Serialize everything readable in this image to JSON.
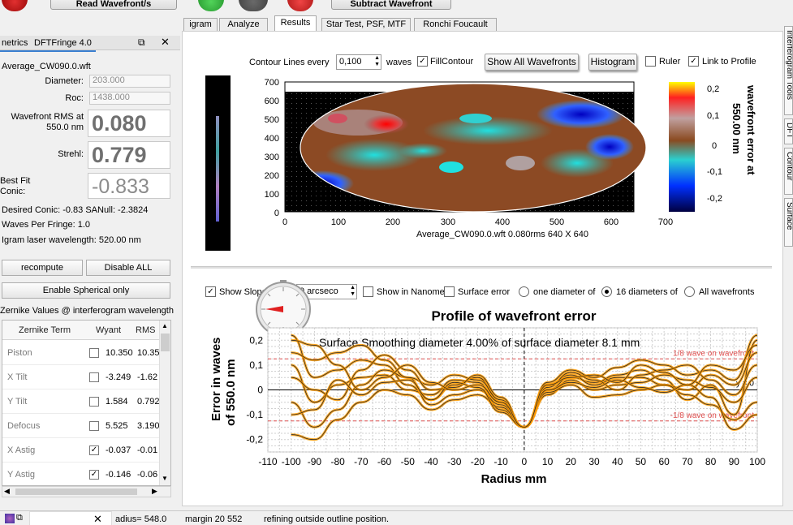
{
  "toolbar": {
    "read_wavefronts_label": "Read Wavefront/s",
    "subtract_wavefront_label": "Subtract Wavefront"
  },
  "tabs": [
    "igram",
    "Analyze",
    "Results",
    "Star Test, PSF, MTF",
    "Ronchi Foucault"
  ],
  "right_tabs": [
    "Interferogram Tools",
    "DFT",
    "Contour",
    "Surface"
  ],
  "dock": {
    "title_left": "netrics",
    "title_right": "DFTFringe 4.0",
    "file_name": "Average_CW090.0.wft",
    "diameter_label": "Diameter:",
    "diameter_value": "203.000",
    "roc_label": "Roc:",
    "roc_value": "1438.000",
    "rms_label_1": "Wavefront RMS at",
    "rms_label_2": "550.0 nm",
    "rms_value": "0.080",
    "strehl_label": "Strehl:",
    "strehl_value": "0.779",
    "bestfit_label_1": "Best Fit",
    "bestfit_label_2": "Conic:",
    "bestfit_value": "-0.833",
    "desired_conic": "Desired Conic:  -0.83 SANull:  -2.3824",
    "waves_per_fringe": "Waves Per Fringe: 1.0",
    "laser_wavelength": "Igram laser wavelength: 520.00 nm",
    "recompute_label": "recompute",
    "disable_all_label": "Disable ALL",
    "enable_spherical_label": "Enable Spherical only",
    "zernike_caption": "Zernike Values @ interferogram wavelength",
    "zernike_headers": [
      "Zernike Term",
      "Wyant",
      "RMS"
    ],
    "zernike_rows": [
      {
        "term": "Piston",
        "checked": "",
        "wyant": "10.350",
        "rms": "10.35"
      },
      {
        "term": "X Tilt",
        "checked": "",
        "wyant": "-3.249",
        "rms": "-1.62"
      },
      {
        "term": "Y Tilt",
        "checked": "",
        "wyant": "1.584",
        "rms": "0.792"
      },
      {
        "term": "Defocus",
        "checked": "",
        "wyant": "5.525",
        "rms": "3.190"
      },
      {
        "term": "X Astig",
        "checked": "✓",
        "wyant": "-0.037",
        "rms": "-0.01"
      },
      {
        "term": "Y Astig",
        "checked": "✓",
        "wyant": "-0.146",
        "rms": "-0.06"
      }
    ]
  },
  "controls": {
    "contour_lines_label": "Contour Lines every",
    "contour_value": "0,100",
    "waves_label": "waves",
    "fill_contour_label": "FillContour",
    "show_all_label": "Show All Wavefronts",
    "histogram_label": "Histogram",
    "ruler_label": "Ruler",
    "link_profile_label": "Link to Profile",
    "show_slope_label": "Show Slope",
    "arcsec_value": "0 arcseco",
    "show_nanometers_label": "Show in Nanome",
    "surface_error_label": "Surface error",
    "one_diameter_label": "one diameter of",
    "sixteen_diameters_label": "16 diameters of",
    "all_wavefronts_label": "All wavefronts"
  },
  "contour_plot": {
    "caption": "Average_CW090.0.wft  0.080rms 640 X 640",
    "colorbar_title_1": "wavefront error at",
    "colorbar_title_2": "550.00 nm",
    "x_ticks": [
      "0",
      "100",
      "200",
      "300",
      "400",
      "500",
      "600",
      "700"
    ],
    "y_ticks": [
      "700",
      "600",
      "500",
      "400",
      "300",
      "200",
      "100",
      "0"
    ],
    "colorbar_ticks": [
      "0,2",
      "0,1",
      "0",
      "-0,1",
      "-0,2"
    ]
  },
  "chart_data": {
    "type": "line",
    "title": "Profile of wavefront error",
    "annotation": "Surface Smoothing diameter   4.00% of surface diameter      8.1 mm",
    "xlabel": "Radius mm",
    "ylabel_1": "Error in waves",
    "ylabel_2": "of  550.0 nm",
    "xlim": [
      -110,
      100
    ],
    "ylim": [
      -0.25,
      0.25
    ],
    "x_ticks": [
      "-110",
      "-100",
      "-90",
      "-80",
      "-70",
      "-60",
      "-50",
      "-40",
      "-30",
      "-20",
      "-10",
      "0",
      "10",
      "20",
      "30",
      "40",
      "50",
      "60",
      "70",
      "80",
      "90",
      "100"
    ],
    "y_ticks": [
      "0,2",
      "0,1",
      "0",
      "-0,1",
      "-0,2"
    ],
    "ref_upper_label": "1/8 wave on wavefront",
    "ref_lower_label": "-1/8 wave on wavefront",
    "zero_label": "y = 0",
    "ref_levels": [
      0.125,
      -0.125
    ],
    "x": [
      -100,
      -90,
      -80,
      -70,
      -60,
      -50,
      -40,
      -30,
      -20,
      -10,
      0,
      10,
      20,
      30,
      40,
      50,
      60,
      70,
      80,
      90,
      100
    ],
    "series": [
      {
        "values": [
          0.22,
          0.05,
          0.08,
          0.12,
          0.1,
          0.02,
          -0.04,
          0.02,
          0.05,
          -0.05,
          -0.15,
          0.0,
          0.05,
          0.03,
          0.06,
          0.08,
          0.04,
          -0.04,
          0.02,
          -0.1,
          0.2
        ]
      },
      {
        "values": [
          0.1,
          -0.05,
          0.02,
          0.05,
          0.06,
          0.0,
          -0.02,
          0.04,
          0.03,
          -0.08,
          -0.15,
          0.02,
          0.06,
          0.02,
          0.05,
          0.05,
          0.02,
          0.0,
          0.06,
          0.02,
          0.15
        ]
      },
      {
        "values": [
          -0.05,
          -0.15,
          -0.08,
          0.02,
          0.08,
          0.05,
          -0.06,
          -0.02,
          0.0,
          -0.06,
          -0.15,
          -0.02,
          0.04,
          0.0,
          0.02,
          0.03,
          0.06,
          0.04,
          0.01,
          -0.05,
          0.05
        ]
      },
      {
        "values": [
          0.15,
          0.12,
          0.15,
          0.18,
          0.12,
          0.05,
          0.02,
          0.06,
          0.04,
          -0.04,
          -0.15,
          0.03,
          0.08,
          0.05,
          0.09,
          0.12,
          0.1,
          0.06,
          0.08,
          0.04,
          0.22
        ]
      },
      {
        "values": [
          -0.18,
          -0.2,
          -0.12,
          -0.05,
          0.0,
          -0.02,
          -0.08,
          -0.04,
          -0.02,
          -0.07,
          -0.15,
          -0.01,
          0.02,
          -0.03,
          -0.02,
          0.0,
          0.02,
          -0.02,
          -0.06,
          -0.12,
          -0.05
        ]
      },
      {
        "values": [
          0.05,
          0.0,
          -0.04,
          0.08,
          0.14,
          0.08,
          0.0,
          0.01,
          0.06,
          -0.03,
          -0.15,
          0.01,
          0.07,
          0.04,
          0.0,
          0.06,
          0.08,
          0.1,
          0.04,
          -0.02,
          0.1
        ]
      },
      {
        "values": [
          -0.1,
          -0.08,
          0.04,
          -0.02,
          0.03,
          0.04,
          -0.04,
          0.03,
          0.01,
          -0.09,
          -0.15,
          0.0,
          0.03,
          0.01,
          0.04,
          0.01,
          -0.01,
          0.02,
          -0.03,
          -0.16,
          -0.1
        ]
      },
      {
        "values": [
          0.2,
          0.18,
          0.1,
          0.0,
          0.05,
          0.1,
          0.03,
          0.0,
          0.02,
          -0.05,
          -0.15,
          0.02,
          0.05,
          0.06,
          0.03,
          0.1,
          0.07,
          0.02,
          0.1,
          0.08,
          0.18
        ]
      }
    ]
  },
  "status": {
    "radius": "adius=  548.0",
    "margin": "margin 20 552",
    "message": "refining outside outline position."
  },
  "colors": {
    "bg": "#f0f0f0",
    "profile_line": "#ff9a00",
    "ref_line": "#e05050"
  }
}
